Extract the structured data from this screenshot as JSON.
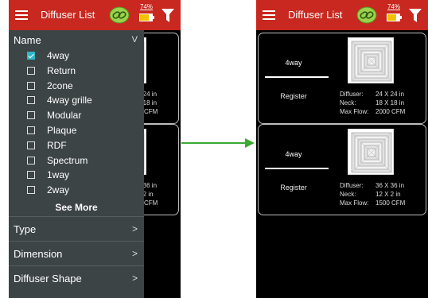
{
  "app": {
    "title": "Diffuser List",
    "battery_percent": "74%",
    "battery_level": 0.74
  },
  "colors": {
    "appbar": "#c8281f",
    "drawer": "#3d4446",
    "checkbox_checked": "#2fb7c8",
    "arrow": "#3aaa35",
    "battery_fill": "#f2c200"
  },
  "icons": {
    "menu": "hamburger-icon",
    "connection": "link-icon",
    "battery": "battery-icon",
    "filter": "funnel-icon"
  },
  "filter_drawer": {
    "header": "Name",
    "header_chevron": "V",
    "options": [
      {
        "label": "4way",
        "checked": true
      },
      {
        "label": "Return",
        "checked": false
      },
      {
        "label": "2cone",
        "checked": false
      },
      {
        "label": "4way grille",
        "checked": false
      },
      {
        "label": "Modular",
        "checked": false
      },
      {
        "label": "Plaque",
        "checked": false
      },
      {
        "label": "RDF",
        "checked": false
      },
      {
        "label": "Spectrum",
        "checked": false
      },
      {
        "label": "1way",
        "checked": false
      },
      {
        "label": "2way",
        "checked": false
      }
    ],
    "see_more": "See More",
    "sections": [
      {
        "label": "Type",
        "chevron": ">"
      },
      {
        "label": "Dimension",
        "chevron": ">"
      },
      {
        "label": "Diffuser Shape",
        "chevron": ">"
      }
    ]
  },
  "diffusers": [
    {
      "name": "4way",
      "register_label": "Register",
      "diffuser_label": "Diffuser:",
      "diffuser_value": "24 X 24 in",
      "neck_label": "Neck:",
      "neck_value": "18 X 18 in",
      "flow_label": "Max Flow:",
      "flow_value": "2000 CFM"
    },
    {
      "name": "4way",
      "register_label": "Register",
      "diffuser_label": "Diffuser:",
      "diffuser_value": "36 X 36 in",
      "neck_label": "Neck:",
      "neck_value": "12 X 2 in",
      "flow_label": "Max Flow:",
      "flow_value": "1500 CFM"
    }
  ]
}
